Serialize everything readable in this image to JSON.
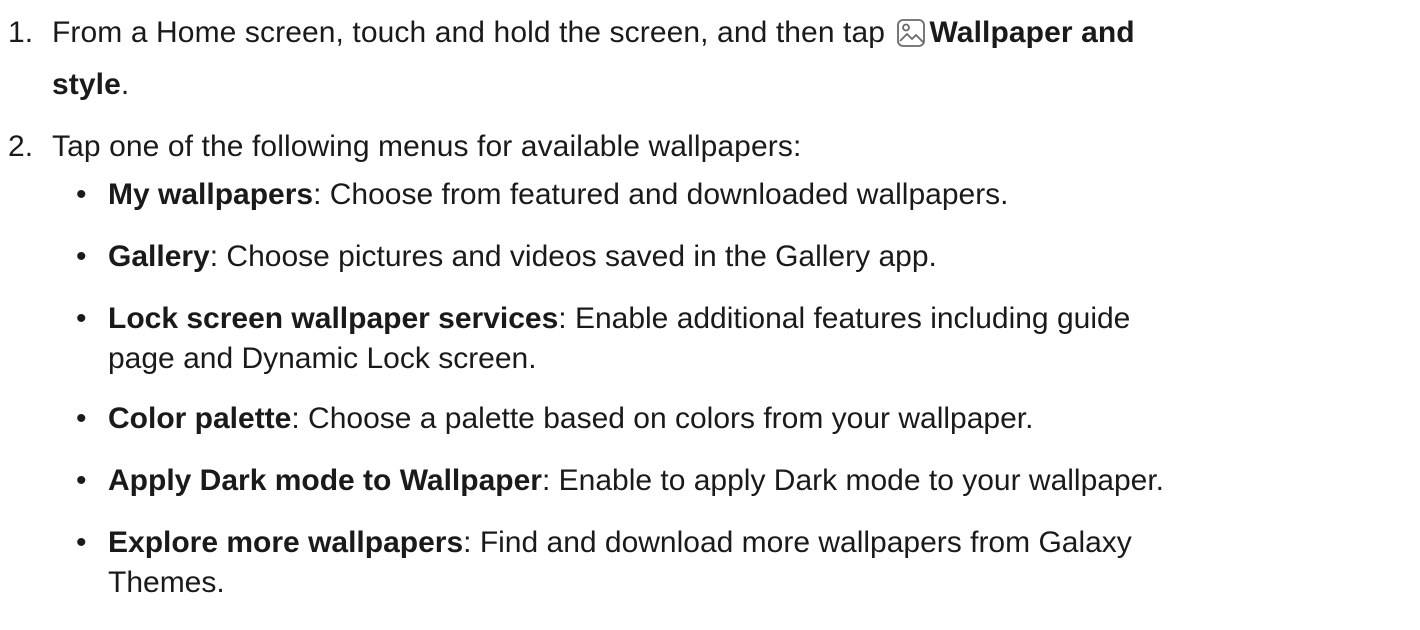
{
  "steps": [
    {
      "number": "1.",
      "text_before": "From a Home screen, touch and hold the screen, and then tap",
      "icon": "wallpaper-gallery-icon",
      "bold": "Wallpaper and",
      "bold_cont": "style",
      "end": "."
    },
    {
      "number": "2.",
      "text": "Tap one of the following menus for available wallpapers:"
    }
  ],
  "bullets": [
    {
      "bold": "My wallpapers",
      "sep": ":",
      "text": " Choose from featured and downloaded wallpapers."
    },
    {
      "bold": "Gallery",
      "sep": ":",
      "text": " Choose pictures and videos saved in the Gallery app."
    },
    {
      "bold": "Lock screen wallpaper services",
      "sep": ":",
      "text": " Enable additional features including guide",
      "cont": "page and Dynamic Lock screen."
    },
    {
      "bold": "Color palette",
      "sep": ":",
      "text": " Choose a palette based on colors from your wallpaper."
    },
    {
      "bold": "Apply Dark mode to Wallpaper",
      "sep": ":",
      "text": " Enable to apply Dark mode to your wallpaper."
    },
    {
      "bold": "Explore more wallpapers",
      "sep": ":",
      "text": " Find and download more wallpapers from Galaxy",
      "cont": "Themes."
    }
  ],
  "bullet_symbol": "•"
}
